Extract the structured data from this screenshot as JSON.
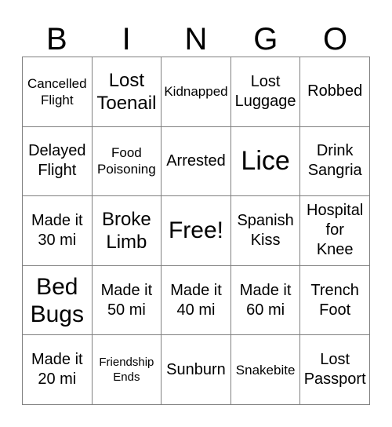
{
  "card": {
    "title": "BINGO",
    "header_letters": [
      "B",
      "I",
      "N",
      "G",
      "O"
    ],
    "columns": 5,
    "rows": 5,
    "colors": {
      "background": "#ffffff",
      "text": "#000000",
      "grid_line": "#808080"
    },
    "cells": [
      {
        "text": "Cancelled\nFlight",
        "size": "sm",
        "free": false
      },
      {
        "text": "Lost\nToenail",
        "size": "lg",
        "free": false
      },
      {
        "text": "Kidnapped",
        "size": "sm",
        "free": false
      },
      {
        "text": "Lost\nLuggage",
        "size": "md",
        "free": false
      },
      {
        "text": "Robbed",
        "size": "md",
        "free": false
      },
      {
        "text": "Delayed\nFlight",
        "size": "md",
        "free": false
      },
      {
        "text": "Food\nPoisoning",
        "size": "sm",
        "free": false
      },
      {
        "text": "Arrested",
        "size": "md",
        "free": false
      },
      {
        "text": "Lice",
        "size": "xxl",
        "free": false
      },
      {
        "text": "Drink\nSangria",
        "size": "md",
        "free": false
      },
      {
        "text": "Made it\n30 mi",
        "size": "md",
        "free": false
      },
      {
        "text": "Broke\nLimb",
        "size": "lg",
        "free": false
      },
      {
        "text": "Free!",
        "size": "xl",
        "free": true
      },
      {
        "text": "Spanish\nKiss",
        "size": "md",
        "free": false
      },
      {
        "text": "Hospital\nfor\nKnee",
        "size": "md",
        "free": false
      },
      {
        "text": "Bed\nBugs",
        "size": "xl",
        "free": false
      },
      {
        "text": "Made it\n50 mi",
        "size": "md",
        "free": false
      },
      {
        "text": "Made it\n40 mi",
        "size": "md",
        "free": false
      },
      {
        "text": "Made it\n60 mi",
        "size": "md",
        "free": false
      },
      {
        "text": "Trench\nFoot",
        "size": "md",
        "free": false
      },
      {
        "text": "Made it\n20 mi",
        "size": "md",
        "free": false
      },
      {
        "text": "Friendship\nEnds",
        "size": "xs",
        "free": false
      },
      {
        "text": "Sunburn",
        "size": "md",
        "free": false
      },
      {
        "text": "Snakebite",
        "size": "sm",
        "free": false
      },
      {
        "text": "Lost\nPassport",
        "size": "md",
        "free": false
      }
    ]
  }
}
